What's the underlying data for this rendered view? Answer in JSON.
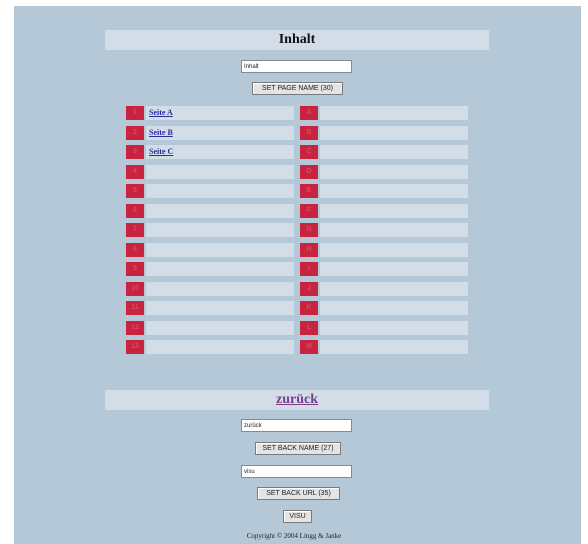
{
  "title": "Inhalt",
  "page_name": {
    "value": "Inhalt",
    "button": "SET PAGE NAME (30)"
  },
  "left_entries": [
    {
      "num": "1",
      "label": "Seite A"
    },
    {
      "num": "2",
      "label": "Seite B"
    },
    {
      "num": "3",
      "label": "Seite C"
    },
    {
      "num": "4",
      "label": ""
    },
    {
      "num": "5",
      "label": ""
    },
    {
      "num": "6",
      "label": ""
    },
    {
      "num": "7",
      "label": ""
    },
    {
      "num": "8",
      "label": ""
    },
    {
      "num": "9",
      "label": ""
    },
    {
      "num": "10",
      "label": ""
    },
    {
      "num": "11",
      "label": ""
    },
    {
      "num": "12",
      "label": ""
    },
    {
      "num": "13",
      "label": ""
    }
  ],
  "right_entries": [
    {
      "num": "A",
      "label": ""
    },
    {
      "num": "B",
      "label": ""
    },
    {
      "num": "C",
      "label": ""
    },
    {
      "num": "D",
      "label": ""
    },
    {
      "num": "E",
      "label": ""
    },
    {
      "num": "F",
      "label": ""
    },
    {
      "num": "G",
      "label": ""
    },
    {
      "num": "H",
      "label": ""
    },
    {
      "num": "I",
      "label": ""
    },
    {
      "num": "J",
      "label": ""
    },
    {
      "num": "K",
      "label": ""
    },
    {
      "num": "L",
      "label": ""
    },
    {
      "num": "M",
      "label": ""
    }
  ],
  "back": {
    "link": "zurück",
    "name_value": "zurück",
    "name_button": "SET BACK NAME (27)",
    "url_value": "visu",
    "url_button": "SET BACK URL (35)",
    "visu_button": "VISU"
  },
  "copyright": "Copyright © 2004 Lingg & Janke",
  "colors": {
    "background": "#b5c8d8",
    "band": "#d3dde7",
    "number_cell": "#c8233f",
    "link": "#2a2f9a",
    "back_link": "#7a3e8e"
  }
}
